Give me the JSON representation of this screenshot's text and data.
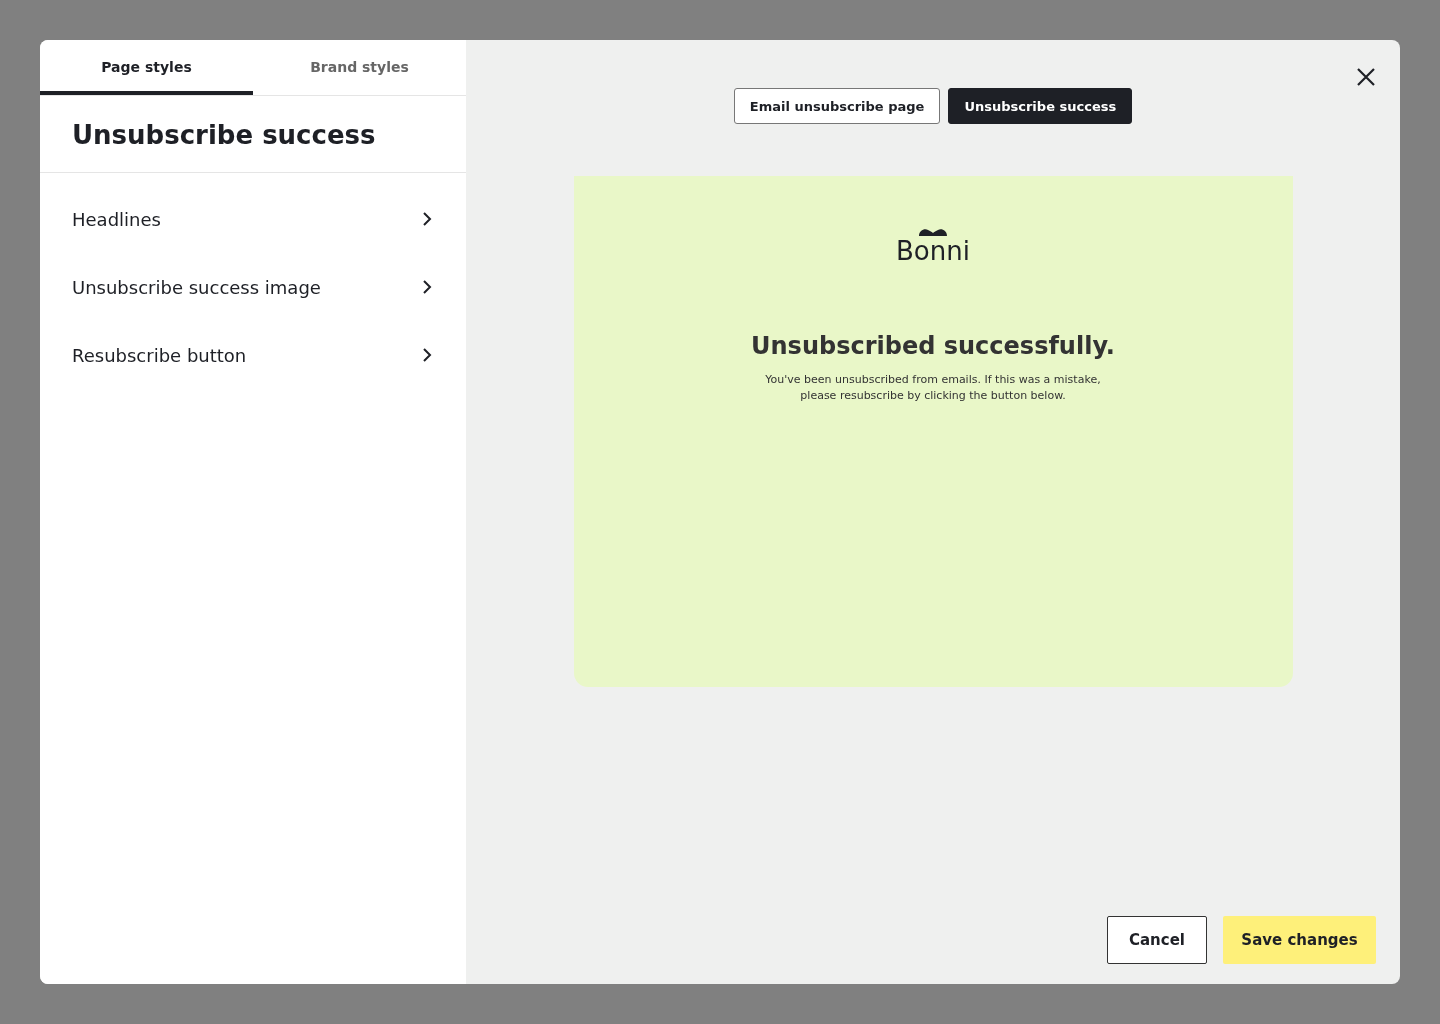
{
  "tabs": [
    {
      "label": "Page styles",
      "selected": true
    },
    {
      "label": "Brand styles",
      "selected": false
    }
  ],
  "sidebar": {
    "title": "Unsubscribe success",
    "items": [
      {
        "label": "Headlines"
      },
      {
        "label": "Unsubscribe success image"
      },
      {
        "label": "Resubscribe button"
      }
    ]
  },
  "view_switch": [
    {
      "label": "Email unsubscribe page",
      "selected": false
    },
    {
      "label": "Unsubscribe success",
      "selected": true
    }
  ],
  "preview": {
    "brand": "Bonni",
    "heading": "Unsubscribed successfully.",
    "message": "You've been unsubscribed from emails. If this was a mistake, please resubscribe by clicking the button below."
  },
  "buttons": {
    "cancel": "Cancel",
    "save": "Save changes"
  }
}
